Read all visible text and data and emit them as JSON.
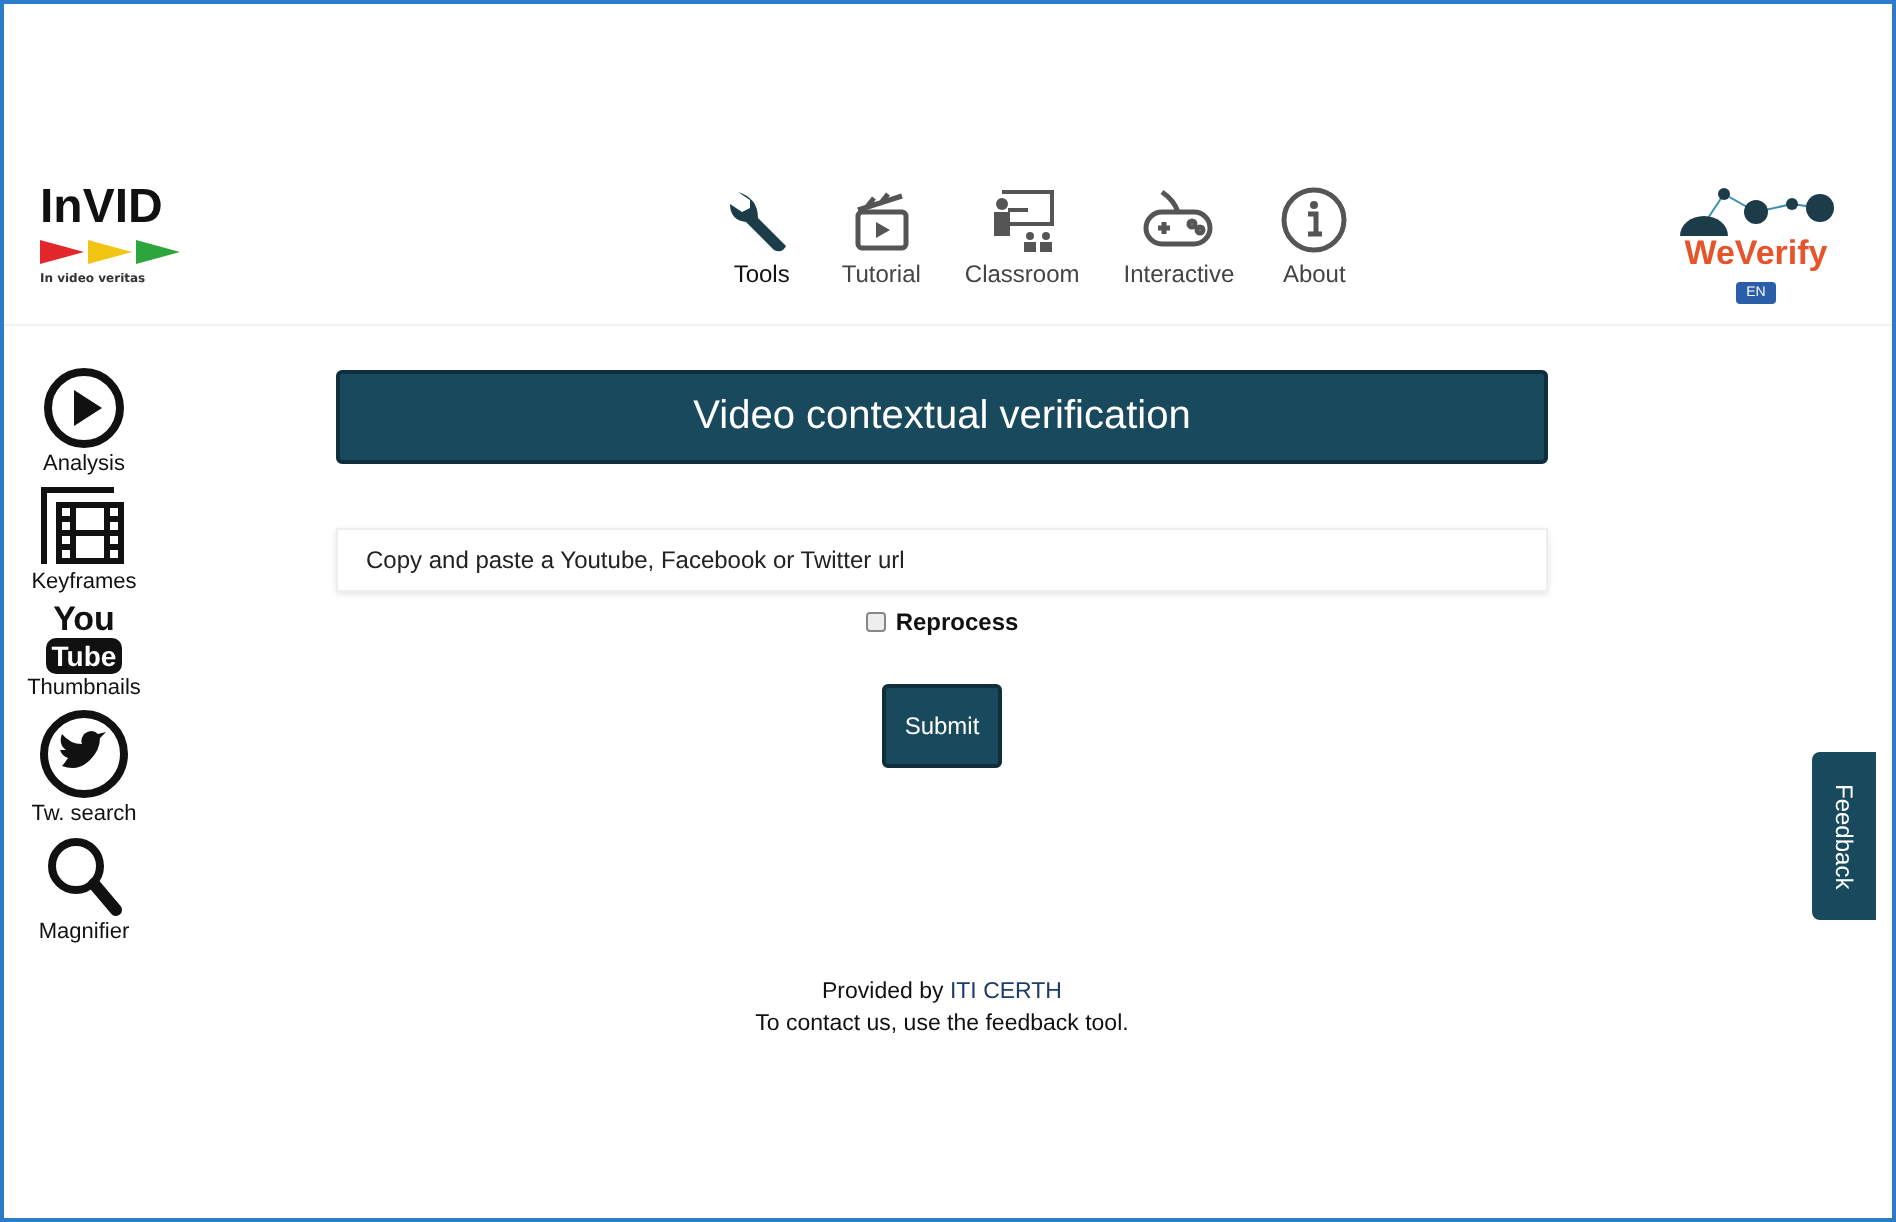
{
  "logo": {
    "title": "InVID",
    "tagline": "In video veritas"
  },
  "nav": [
    {
      "label": "Tools",
      "selected": true
    },
    {
      "label": "Tutorial",
      "selected": false
    },
    {
      "label": "Classroom",
      "selected": false
    },
    {
      "label": "Interactive",
      "selected": false
    },
    {
      "label": "About",
      "selected": false
    }
  ],
  "partner_logo": {
    "title": "WeVerify",
    "language": "EN"
  },
  "sidebar": {
    "items": [
      {
        "label": "Analysis"
      },
      {
        "label": "Keyframes"
      },
      {
        "label": "Thumbnails",
        "logo_top": "You",
        "logo_bottom": "Tube"
      },
      {
        "label": "Tw. search"
      },
      {
        "label": "Magnifier"
      }
    ]
  },
  "main": {
    "title": "Video contextual verification",
    "url_field": {
      "placeholder": "Copy and paste a Youtube, Facebook or Twitter url"
    },
    "reprocess": {
      "label": "Reprocess",
      "checked": false
    },
    "submit": "Submit"
  },
  "footer": {
    "provided_by": "Provided by",
    "link": "ITI CERTH",
    "contact": "To contact us, use the feedback tool."
  },
  "feedback_tab": "Feedback"
}
